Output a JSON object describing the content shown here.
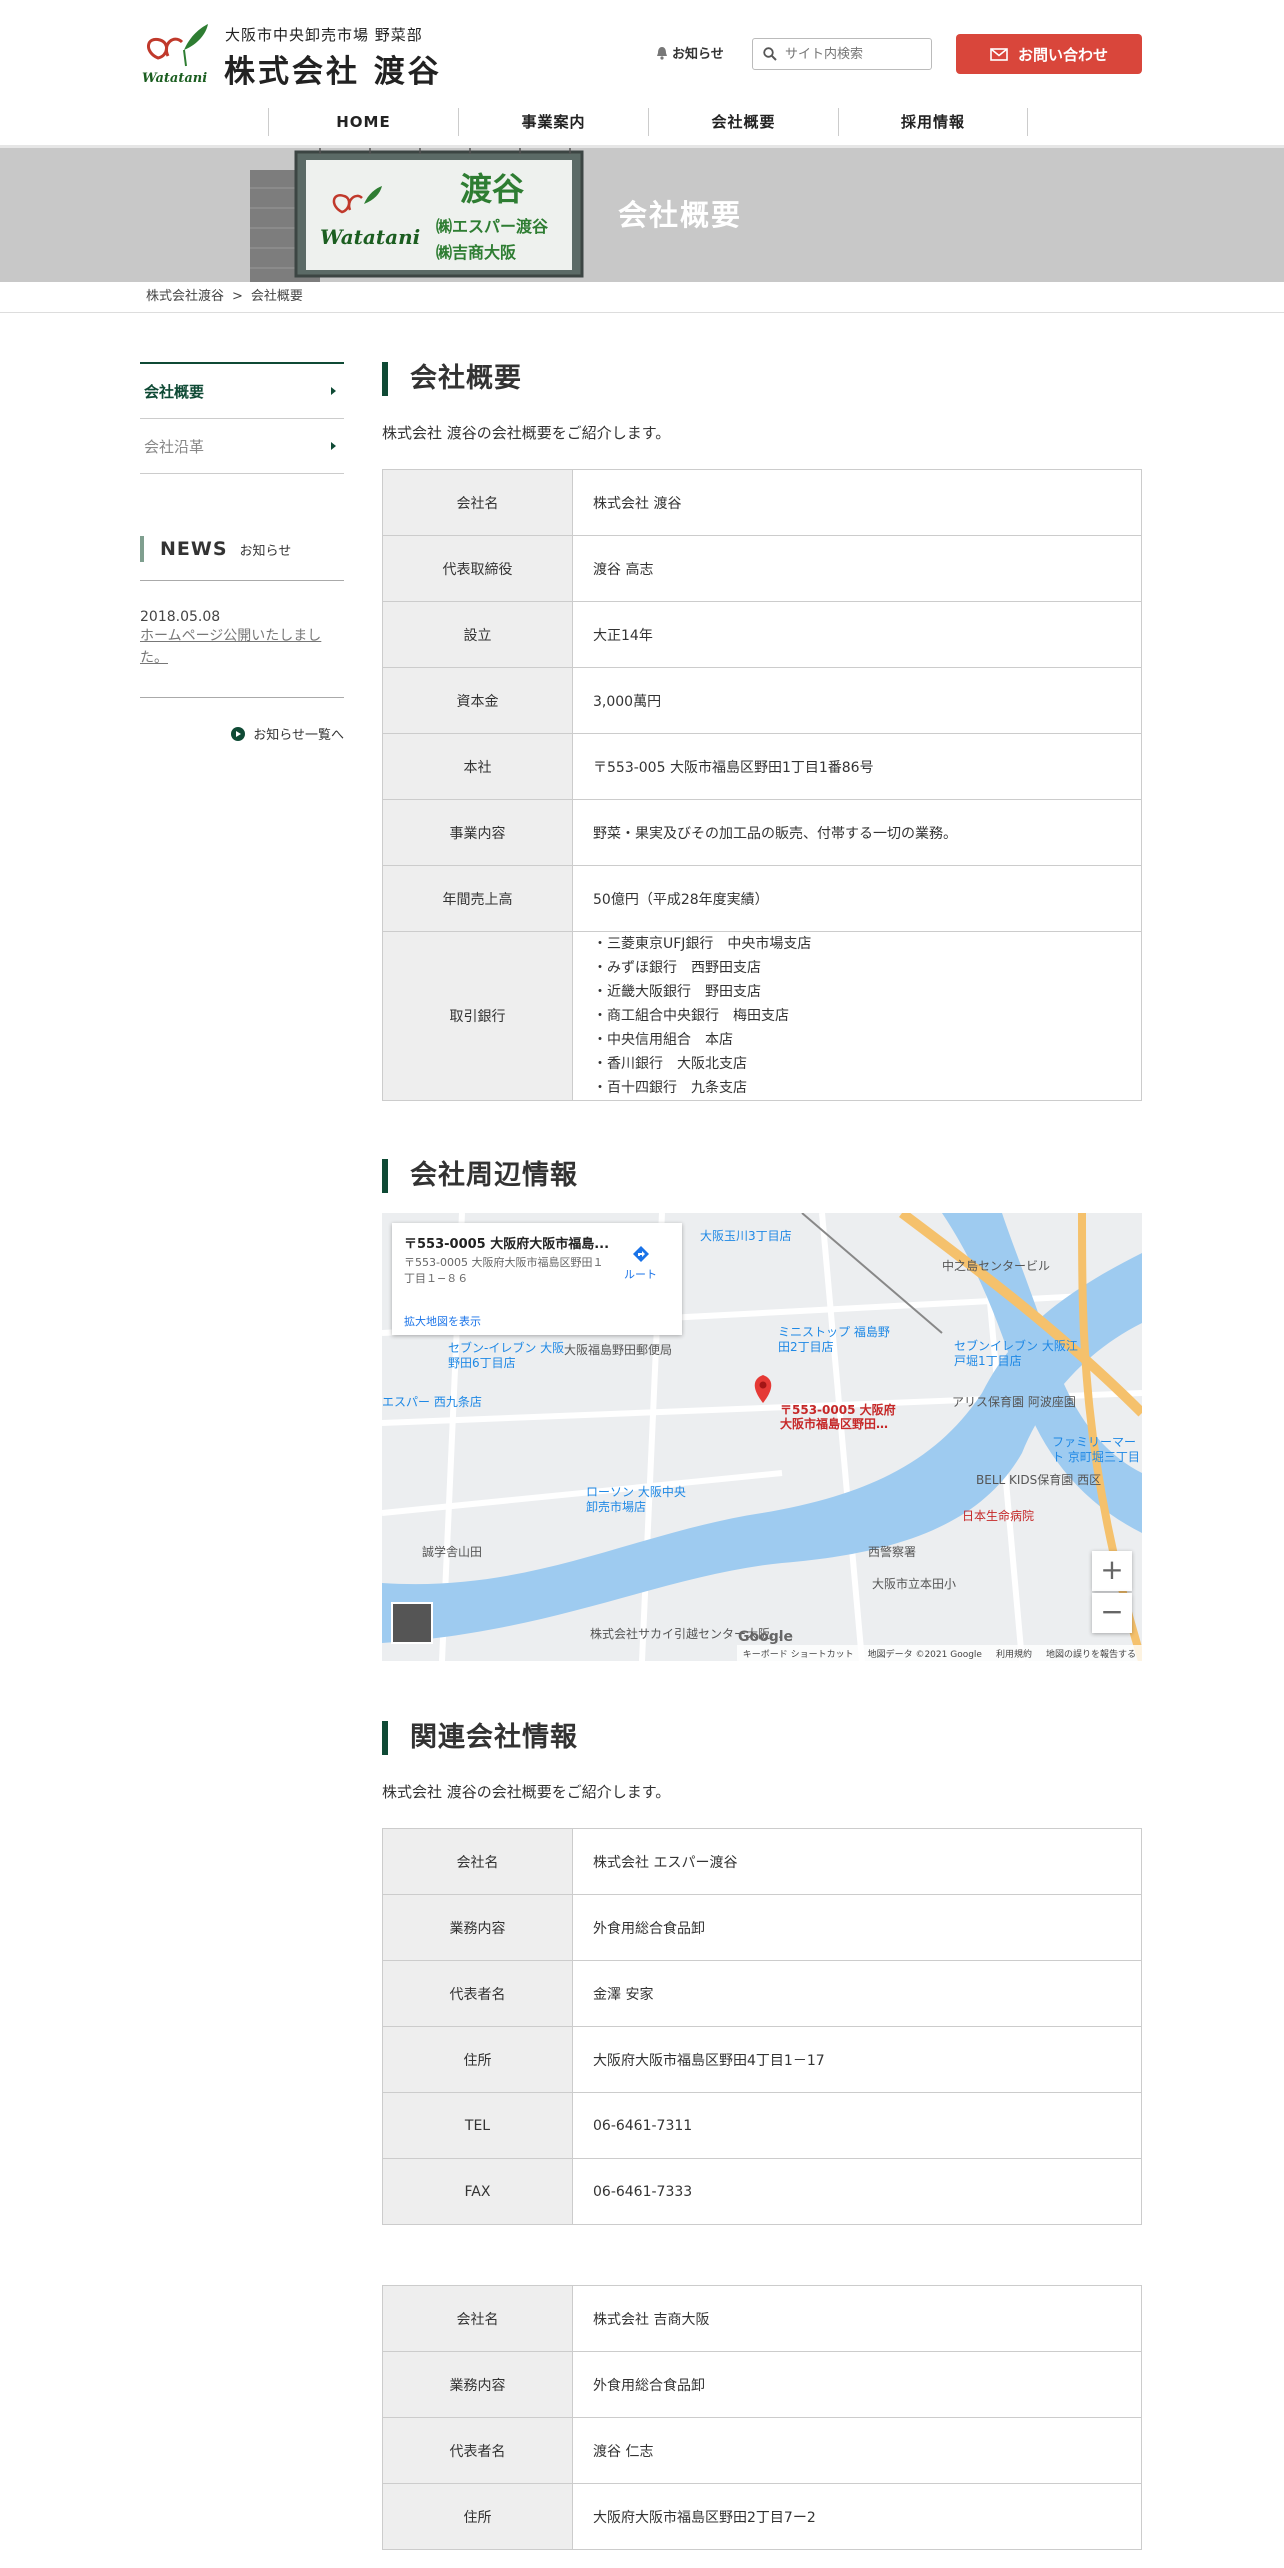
{
  "header": {
    "logo_mark_text": "Watatani",
    "logo_sub": "大阪市中央卸売市場 野菜部",
    "logo_name": "株式会社 渡谷",
    "news_link": "お知らせ",
    "search_placeholder": "サイト内検索",
    "contact_label": "お問い合わせ",
    "nav": [
      "HOME",
      "事業案内",
      "会社概要",
      "採用情報"
    ]
  },
  "hero": {
    "title": "会社概要",
    "sign_text": "渡谷",
    "sign_sub1": "㈱エスパー渡谷",
    "sign_sub2": "㈱吉商大阪"
  },
  "breadcrumb": [
    "株式会社渡谷",
    ">",
    "会社概要"
  ],
  "sidebar": {
    "menu": [
      "会社概要",
      "会社沿革"
    ],
    "news_title": "NEWS",
    "news_sub": "お知らせ",
    "news_items": [
      {
        "date": "2018.05.08",
        "text": "ホームページ公開いたしました。"
      }
    ],
    "news_all": "お知らせ一覧へ"
  },
  "overview": {
    "title": "会社概要",
    "lead": "株式会社 渡谷の会社概要をご紹介します。",
    "rows": [
      {
        "label": "会社名",
        "value": "株式会社 渡谷"
      },
      {
        "label": "代表取締役",
        "value": "渡谷 高志"
      },
      {
        "label": "設立",
        "value": "大正14年"
      },
      {
        "label": "資本金",
        "value": "3,000萬円"
      },
      {
        "label": "本社",
        "value": "〒553-005 大阪市福島区野田1丁目1番86号"
      },
      {
        "label": "事業内容",
        "value": "野菜・果実及びその加工品の販売、付帯する一切の業務。"
      },
      {
        "label": "年間売上高",
        "value": "50億円（平成28年度実績）"
      }
    ],
    "banks_label": "取引銀行",
    "banks": [
      "・三菱東京UFJ銀行　中央市場支店",
      "・みずほ銀行　西野田支店",
      "・近畿大阪銀行　野田支店",
      "・商工組合中央銀行　梅田支店",
      "・中央信用組合　本店",
      "・香川銀行　大阪北支店",
      "・百十四銀行　九条支店"
    ]
  },
  "area": {
    "title": "会社周辺情報",
    "map": {
      "card_title": "〒553-0005 大阪府大阪市福島...",
      "card_addr": "〒553-0005 大阪府大阪市福島区野田１丁目１−８６",
      "card_link": "拡大地図を表示",
      "route": "ルート",
      "pin_label": "〒553-0005 大阪府大阪市福島区野田…",
      "labels": [
        "大阪玉川3丁目店",
        "中之島センタービル",
        "セブン-イレブン 大阪野田6丁目店",
        "大阪福島野田郵便局",
        "ミニストップ 福島野田2丁目店",
        "セブンイレブン 大阪江戸堀1丁目店",
        "ローソン 大阪中央卸売市場店",
        "BELL KIDS保育園 西区",
        "日本生命病院",
        "大阪市立本田小",
        "西警察署",
        "株式会社サカイ引越センター大阪…",
        "エスパー 西九条店",
        "誠学舎山田",
        "アリス保育園 阿波座園",
        "ファミリーマート 京町堀三丁目"
      ],
      "footer": [
        "キーボード ショートカット",
        "地図データ ©2021 Google",
        "利用規約",
        "地図の誤りを報告する"
      ],
      "google": "Google"
    }
  },
  "related": {
    "title": "関連会社情報",
    "lead": "株式会社 渡谷の会社概要をご紹介します。",
    "company1": [
      {
        "label": "会社名",
        "value": "株式会社 エスパー渡谷"
      },
      {
        "label": "業務内容",
        "value": "外食用総合食品卸"
      },
      {
        "label": "代表者名",
        "value": "金澤 安家"
      },
      {
        "label": "住所",
        "value": "大阪府大阪市福島区野田4丁目1－17"
      },
      {
        "label": "TEL",
        "value": "06-6461-7311"
      },
      {
        "label": "FAX",
        "value": "06-6461-7333"
      }
    ],
    "company2": [
      {
        "label": "会社名",
        "value": "株式会社 吉商大阪"
      },
      {
        "label": "業務内容",
        "value": "外食用総合食品卸"
      },
      {
        "label": "代表者名",
        "value": "渡谷 仁志"
      },
      {
        "label": "住所",
        "value": "大阪府大阪市福島区野田2丁目7ー2"
      }
    ]
  },
  "colors": {
    "brand_green": "#0f4a35",
    "accent_red": "#d9463b",
    "hero_gray": "#c8c8c8"
  }
}
